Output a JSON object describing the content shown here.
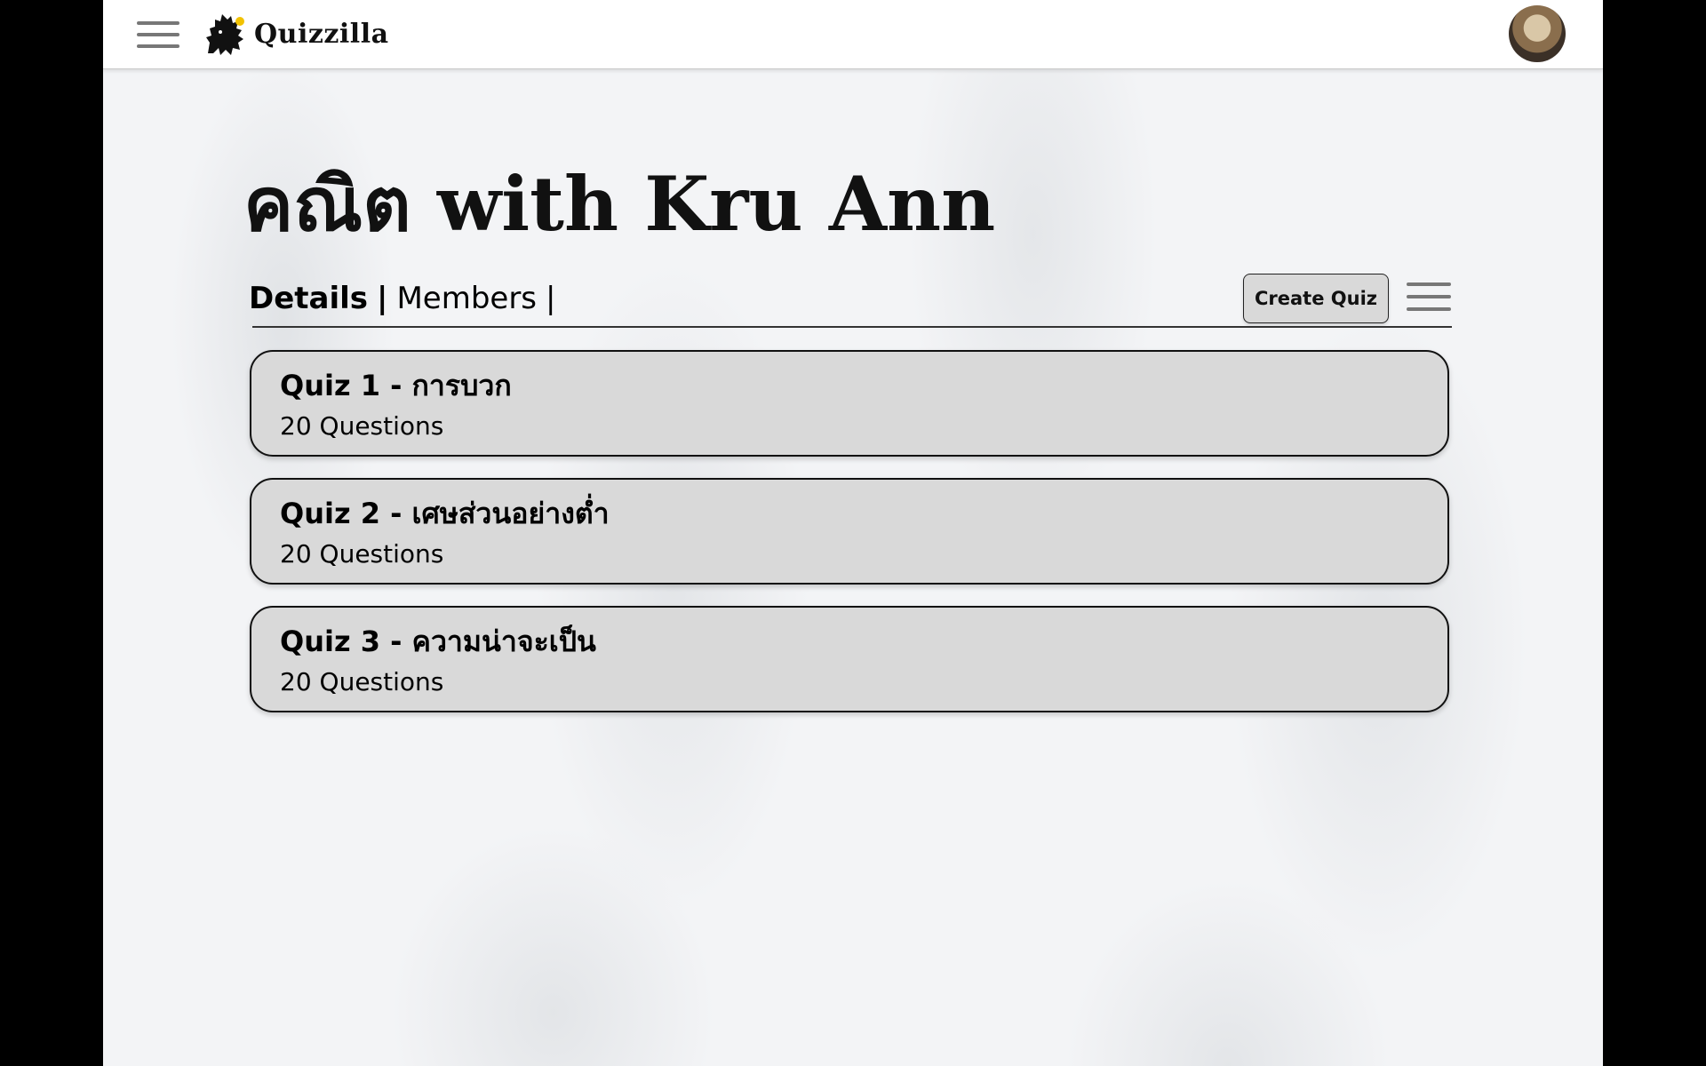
{
  "app": {
    "name": "Quizzilla",
    "icons": {
      "menu": "hamburger-menu-icon",
      "logo": "godzilla-logo-icon",
      "avatar": "user-avatar"
    }
  },
  "classroom": {
    "title": "คณิต with Kru Ann"
  },
  "tabs": [
    {
      "label": "Details",
      "active": true
    },
    {
      "sep": "|"
    },
    {
      "label": "Members",
      "active": false
    },
    {
      "sep": "|"
    }
  ],
  "toolbar": {
    "create_quiz_label": "Create Quiz"
  },
  "quizzes": [
    {
      "title": "Quiz 1 - การบวก",
      "subtitle": "20 Questions"
    },
    {
      "title": "Quiz 2 - เศษส่วนอย่างต่ำ",
      "subtitle": "20 Questions"
    },
    {
      "title": "Quiz 3 - ความน่าจะเป็น",
      "subtitle": "20 Questions"
    }
  ],
  "colors": {
    "card_bg": "#d9d9d9",
    "page_bg": "#f3f4f6",
    "border": "#111111"
  }
}
